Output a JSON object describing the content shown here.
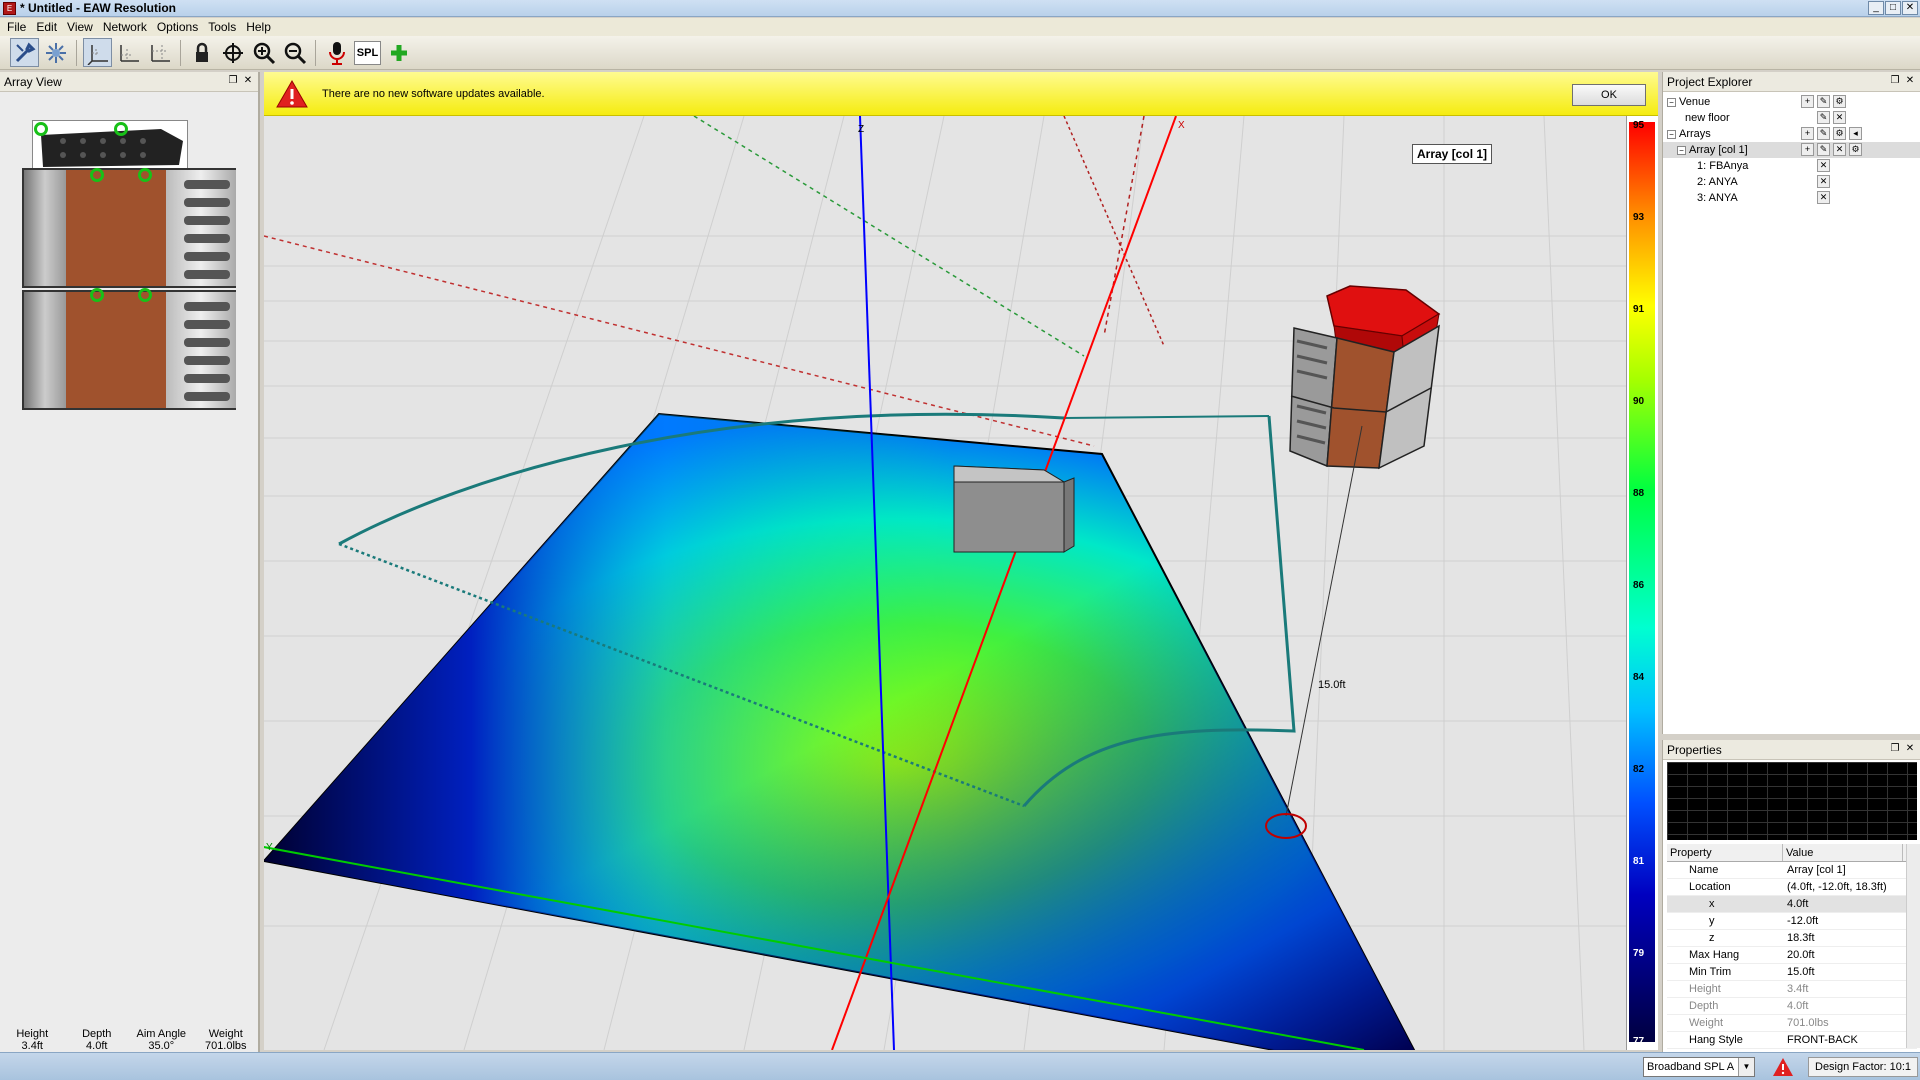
{
  "window": {
    "title": "* Untitled - EAW Resolution",
    "app_icon_glyph": "E",
    "minimize": "_",
    "maximize": "□",
    "close": "✕"
  },
  "menu": [
    "File",
    "Edit",
    "View",
    "Network",
    "Options",
    "Tools",
    "Help"
  ],
  "toolbar": {
    "spl_label": "SPL",
    "icons": [
      "tools-icon",
      "network-icon",
      "axis-xy-icon",
      "axis-xz-icon",
      "axis-yz-icon",
      "lock-icon",
      "crosshair-icon",
      "zoom-in-icon",
      "zoom-out-icon",
      "microphone-icon",
      "spl-icon",
      "add-icon"
    ]
  },
  "array_view": {
    "title": "Array View",
    "specs": [
      {
        "label": "Height",
        "value": "3.4ft"
      },
      {
        "label": "Depth",
        "value": "4.0ft"
      },
      {
        "label": "Aim Angle",
        "value": "35.0°"
      },
      {
        "label": "Weight",
        "value": "701.0lbs"
      }
    ]
  },
  "notification": {
    "message": "There are no new software updates available.",
    "ok_label": "OK"
  },
  "viewport": {
    "axis_z": "Z",
    "axis_x": "X",
    "axis_y": "Y",
    "dimension_label": "15.0ft",
    "tooltip": "Array [col 1]"
  },
  "colorbar": {
    "labels": [
      "95",
      "93",
      "91",
      "90",
      "88",
      "86",
      "84",
      "82",
      "81",
      "79",
      "77"
    ]
  },
  "project_explorer": {
    "title": "Project Explorer",
    "items": [
      {
        "label": "Venue",
        "level": 0,
        "expander": "−"
      },
      {
        "label": "new floor",
        "level": 1,
        "expander": ""
      },
      {
        "label": "Arrays",
        "level": 0,
        "expander": "−"
      },
      {
        "label": "Array [col 1]",
        "level": 1,
        "expander": "−"
      },
      {
        "label": "1: FBAnya",
        "level": 2,
        "expander": ""
      },
      {
        "label": "2: ANYA",
        "level": 2,
        "expander": ""
      },
      {
        "label": "3: ANYA",
        "level": 2,
        "expander": ""
      }
    ]
  },
  "properties": {
    "title": "Properties",
    "col_property": "Property",
    "col_value": "Value",
    "rows": [
      {
        "key": "Name",
        "value": "Array [col 1]"
      },
      {
        "key": "Location",
        "value": "(4.0ft, -12.0ft, 18.3ft)"
      },
      {
        "key": "x",
        "value": "4.0ft"
      },
      {
        "key": "y",
        "value": "-12.0ft"
      },
      {
        "key": "z",
        "value": "18.3ft"
      },
      {
        "key": "Max Hang",
        "value": "20.0ft"
      },
      {
        "key": "Min Trim",
        "value": "15.0ft"
      },
      {
        "key": "Height",
        "value": "3.4ft"
      },
      {
        "key": "Depth",
        "value": "4.0ft"
      },
      {
        "key": "Weight",
        "value": "701.0lbs"
      },
      {
        "key": "Hang Style",
        "value": "FRONT-BACK"
      }
    ]
  },
  "status": {
    "mode": "Broadband SPL A",
    "design_factor": "Design Factor: 10:1"
  },
  "colors": {
    "accent": "#0000cc",
    "x_axis": "#ff0000",
    "y_axis": "#00cc00",
    "z_axis": "#0000ff",
    "speaker_top": "#e01010"
  }
}
